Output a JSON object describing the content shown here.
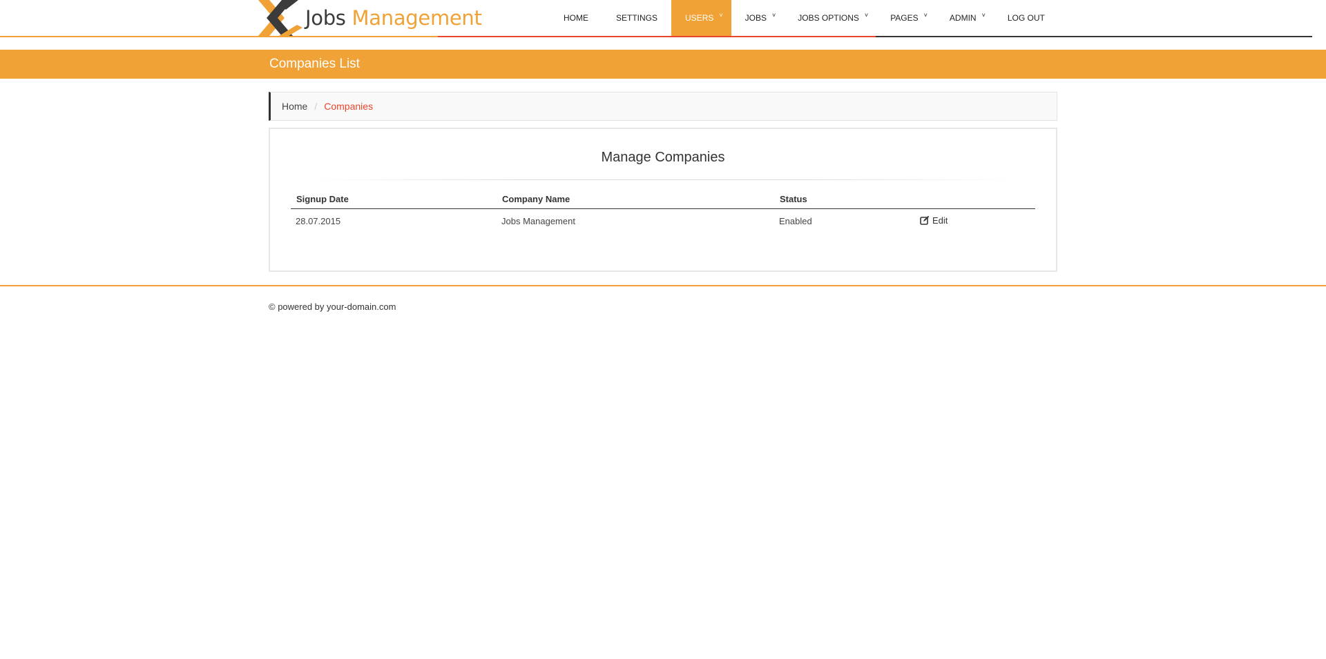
{
  "brand": {
    "name_part1": "Jobs",
    "name_part2": "Management",
    "colors": {
      "accent": "#f0a236",
      "dark": "#3b3b3b",
      "red": "#e8452c"
    }
  },
  "nav": {
    "items": [
      {
        "label": "HOME",
        "dropdown": false,
        "active": false
      },
      {
        "label": "SETTINGS",
        "dropdown": false,
        "active": false
      },
      {
        "label": "USERS",
        "dropdown": true,
        "active": true
      },
      {
        "label": "JOBS",
        "dropdown": true,
        "active": false
      },
      {
        "label": "JOBS OPTIONS",
        "dropdown": true,
        "active": false
      },
      {
        "label": "PAGES",
        "dropdown": true,
        "active": false
      },
      {
        "label": "ADMIN",
        "dropdown": true,
        "active": false
      },
      {
        "label": "LOG OUT",
        "dropdown": false,
        "active": false
      }
    ],
    "caret_icon": "chevron-down-icon"
  },
  "page": {
    "title": "Companies List"
  },
  "breadcrumb": {
    "home": "Home",
    "separator": "/",
    "current": "Companies"
  },
  "panel": {
    "title": "Manage Companies"
  },
  "table": {
    "headers": [
      "Signup Date",
      "Company Name",
      "Status",
      ""
    ],
    "rows": [
      {
        "signup_date": "28.07.2015",
        "company_name": "Jobs Management",
        "status": "Enabled",
        "action": "Edit",
        "action_icon": "edit-icon"
      }
    ]
  },
  "footer": {
    "text": "© powered by your-domain.com"
  }
}
